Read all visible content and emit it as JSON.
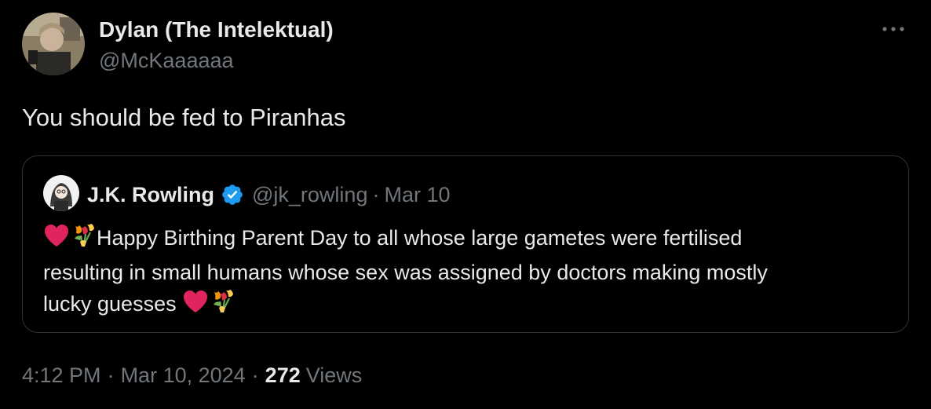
{
  "tweet": {
    "author": {
      "name": "Dylan (The Intelektual)",
      "handle": "@McKaaaaaa"
    },
    "text": "You should be fed to Piranhas",
    "quoted": {
      "author_name": "J.K. Rowling",
      "author_handle": "@jk_rowling",
      "separator": "·",
      "date": "Mar 10",
      "lines": [
        "Happy Birthing Parent Day to all whose large gametes were fertilised",
        "resulting in small humans whose sex was assigned by doctors making mostly",
        "lucky guesses"
      ],
      "emojis": [
        "heart-emoji",
        "tulip-bouquet-emoji"
      ]
    },
    "meta": {
      "time": "4:12 PM",
      "separator": "·",
      "date": "Mar 10, 2024",
      "views_count": "272",
      "views_label": "Views"
    }
  },
  "colors": {
    "background": "#000000",
    "text_primary": "#e7e9ea",
    "text_secondary": "#71767b",
    "border": "#2f3336",
    "verified": "#1d9bf0",
    "heart": "#e0245e"
  }
}
